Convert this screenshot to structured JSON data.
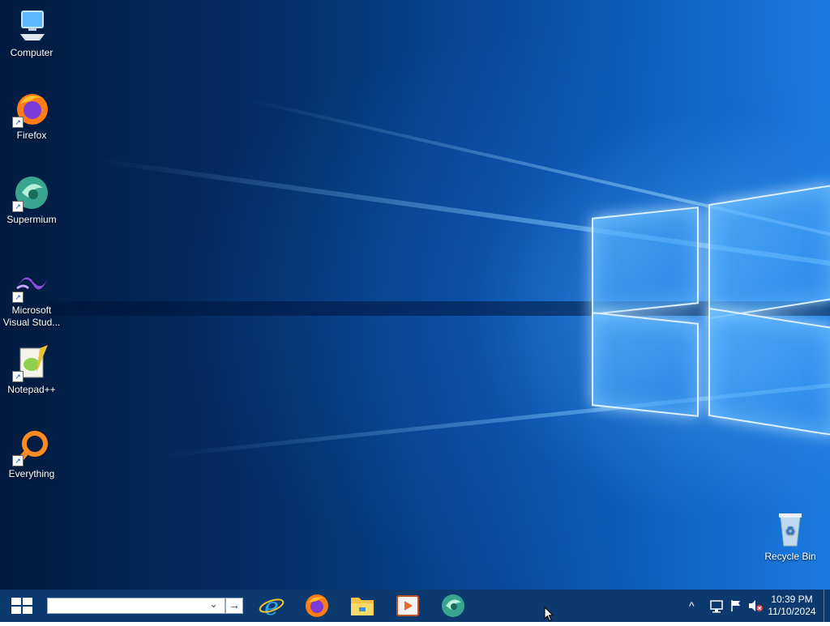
{
  "desktop": {
    "icons": [
      {
        "label": "Computer",
        "icon": "computer-icon"
      },
      {
        "label": "Firefox",
        "icon": "firefox-icon"
      },
      {
        "label": "Supermium",
        "icon": "supermium-icon"
      },
      {
        "label": "Microsoft Visual Stud...",
        "icon": "visual-studio-icon"
      },
      {
        "label": "Notepad++",
        "icon": "notepadpp-icon"
      },
      {
        "label": "Everything",
        "icon": "everything-icon"
      }
    ],
    "recycle_bin": {
      "label": "Recycle Bin",
      "icon": "recycle-bin-icon"
    }
  },
  "taskbar": {
    "start_icon": "windows-start-icon",
    "search": {
      "value": "",
      "submit_glyph": "→",
      "dropdown_glyph": "⌄"
    },
    "pinned": [
      {
        "name": "Internet Explorer",
        "icon": "internet-explorer-icon"
      },
      {
        "name": "Firefox",
        "icon": "firefox-icon"
      },
      {
        "name": "File Explorer",
        "icon": "file-explorer-icon"
      },
      {
        "name": "Media Player",
        "icon": "media-player-icon"
      },
      {
        "name": "Supermium",
        "icon": "supermium-icon"
      }
    ],
    "tray": {
      "chevron_glyph": "^",
      "time": "10:39 PM",
      "date": "11/10/2024"
    }
  },
  "colors": {
    "taskbar": "#0d3a6e",
    "desktop_dark": "#021a3f",
    "desktop_light": "#1b7be0"
  }
}
